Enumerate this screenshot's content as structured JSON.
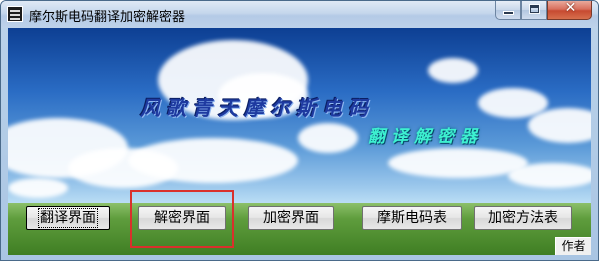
{
  "window": {
    "title": "摩尔斯电码翻译加密解密器",
    "close_symbol": "✕"
  },
  "banner": {
    "line1": "风歌青天摩尔斯电码",
    "line2": "翻译解密器"
  },
  "buttons": {
    "translate": "翻译界面",
    "decrypt": "解密界面",
    "encrypt": "加密界面",
    "morse_table": "摩斯电码表",
    "method_table": "加密方法表",
    "author": "作者"
  },
  "colors": {
    "highlight": "#d9302c"
  }
}
